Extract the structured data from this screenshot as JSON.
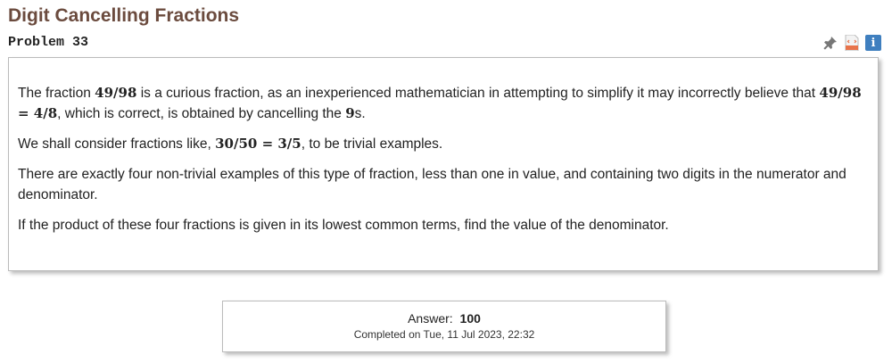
{
  "page": {
    "title": "Digit Cancelling Fractions",
    "problem_label": "Problem 33"
  },
  "toolbar": {
    "icons": [
      "pin-icon",
      "html-file-icon",
      "info-icon"
    ],
    "info_glyph": "i"
  },
  "problem": {
    "p1": {
      "t1": "The fraction ",
      "m1": "49/98",
      "t2": " is a curious fraction, as an inexperienced mathematician in attempting to simplify it may incorrectly believe that ",
      "m2": "49/98 = 4/8",
      "t3": ", which is correct, is obtained by cancelling the ",
      "m3": "9",
      "t4": "s."
    },
    "p2": {
      "t1": "We shall consider fractions like, ",
      "m1": "30/50 = 3/5",
      "t2": ", to be trivial examples."
    },
    "p3": "There are exactly four non-trivial examples of this type of fraction, less than one in value, and containing two digits in the numerator and denominator.",
    "p4": "If the product of these four fractions is given in its lowest common terms, find the value of the denominator."
  },
  "answer": {
    "label": "Answer:",
    "value": "100",
    "completed": "Completed on Tue, 11 Jul 2023, 22:32"
  },
  "colors": {
    "title": "#6b4b3e",
    "info_icon_bg": "#3f7fbf",
    "html_icon": "#e8734a",
    "border": "#bbbbbb"
  }
}
